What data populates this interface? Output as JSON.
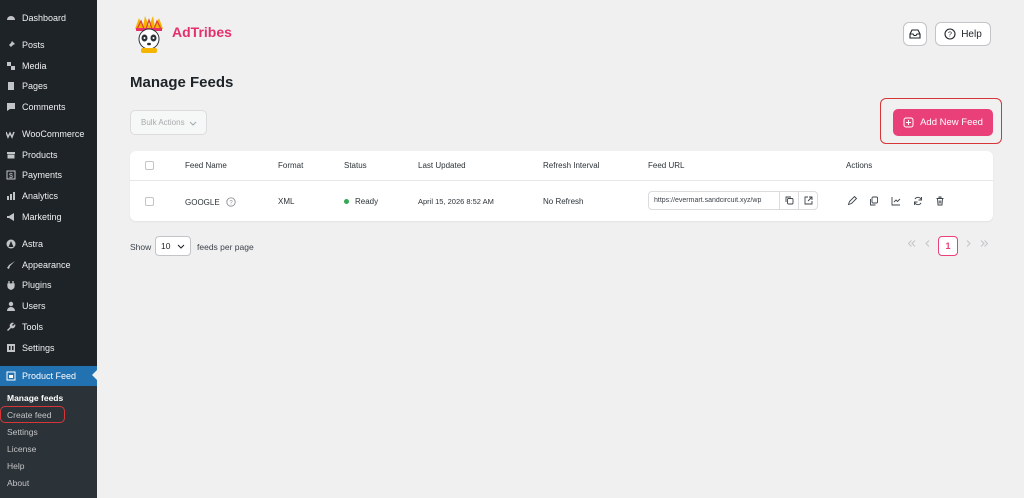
{
  "sidebar": {
    "items": [
      {
        "label": "Dashboard",
        "icon": "dashboard-icon"
      },
      {
        "label": "Posts",
        "icon": "pin-icon"
      },
      {
        "label": "Media",
        "icon": "media-icon"
      },
      {
        "label": "Pages",
        "icon": "pages-icon"
      },
      {
        "label": "Comments",
        "icon": "comment-icon"
      },
      {
        "label": "WooCommerce",
        "icon": "woo-icon"
      },
      {
        "label": "Products",
        "icon": "archive-icon"
      },
      {
        "label": "Payments",
        "icon": "dollar-icon"
      },
      {
        "label": "Analytics",
        "icon": "bar-chart-icon"
      },
      {
        "label": "Marketing",
        "icon": "megaphone-icon"
      },
      {
        "label": "Astra",
        "icon": "astra-icon"
      },
      {
        "label": "Appearance",
        "icon": "brush-icon"
      },
      {
        "label": "Plugins",
        "icon": "plug-icon"
      },
      {
        "label": "Users",
        "icon": "user-icon"
      },
      {
        "label": "Tools",
        "icon": "wrench-icon"
      },
      {
        "label": "Settings",
        "icon": "settings-icon"
      },
      {
        "label": "Product Feed",
        "icon": "feed-icon"
      }
    ],
    "submenu": [
      "Manage feeds",
      "Create feed",
      "Settings",
      "License",
      "Help",
      "About"
    ]
  },
  "header": {
    "brand": "AdTribes",
    "help_label": "Help"
  },
  "page": {
    "title": "Manage Feeds",
    "bulk_actions": "Bulk Actions",
    "add_feed": "Add New Feed"
  },
  "table": {
    "headers": [
      "Feed Name",
      "Format",
      "Status",
      "Last Updated",
      "Refresh Interval",
      "Feed URL",
      "Actions"
    ],
    "rows": [
      {
        "name": "GOOGLE",
        "format": "XML",
        "status": "Ready",
        "updated": "April 15, 2026 8:52 AM",
        "refresh": "No Refresh",
        "url": "https://evermart.sandcircuit.xyz/wp"
      }
    ]
  },
  "footer": {
    "show": "Show",
    "per_page_value": "10",
    "per_page_label": "feeds per page",
    "current_page": "1"
  },
  "colors": {
    "accent": "#e9407a",
    "sidebar": "#1d2327",
    "active": "#2271b1",
    "status_ready": "#34a853",
    "highlight": "#d63638"
  }
}
